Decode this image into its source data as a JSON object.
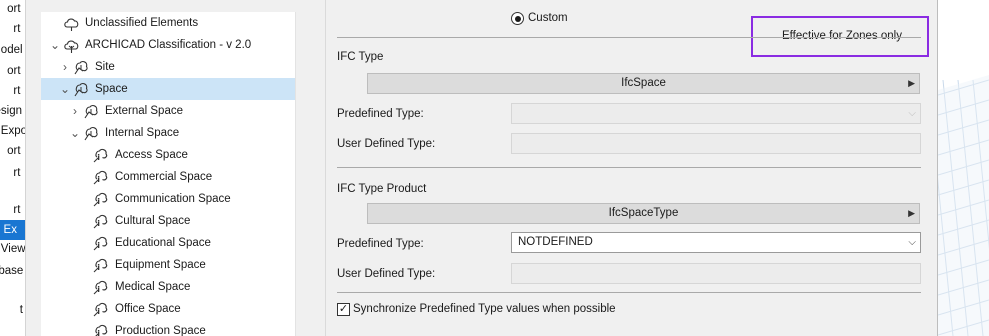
{
  "left_list": {
    "items": [
      {
        "text": "ort",
        "selected": false
      },
      {
        "text": "rt",
        "selected": false
      },
      {
        "text": "odel",
        "selected": false
      },
      {
        "text": "ort",
        "selected": false
      },
      {
        "text": "rt",
        "selected": false
      },
      {
        "text": "esign",
        "selected": false
      },
      {
        "text": "Expo",
        "selected": false
      },
      {
        "text": "ort",
        "selected": false
      },
      {
        "text": "rt",
        "selected": false
      },
      {
        "text": "rt",
        "selected": false
      },
      {
        "text": "ric Ex",
        "selected": true
      },
      {
        "text": "View",
        "selected": false
      },
      {
        "text": "-base",
        "selected": false
      },
      {
        "text": "t",
        "selected": false
      }
    ]
  },
  "tree": {
    "items": [
      {
        "label": "Unclassified Elements",
        "level": 0,
        "chevron": "",
        "icon": "unclassified-icon",
        "selected": false
      },
      {
        "label": "ARCHICAD Classification - v 2.0",
        "level": 0,
        "chevron": "⌄",
        "icon": "classification-icon",
        "selected": false
      },
      {
        "label": "Site",
        "level": 1,
        "chevron": "›",
        "icon": "zone-class-icon",
        "selected": false
      },
      {
        "label": "Space",
        "level": 1,
        "chevron": "⌄",
        "icon": "zone-class-icon",
        "selected": true
      },
      {
        "label": "External Space",
        "level": 2,
        "chevron": "›",
        "icon": "zone-class-icon",
        "selected": false
      },
      {
        "label": "Internal Space",
        "level": 2,
        "chevron": "⌄",
        "icon": "zone-class-icon",
        "selected": false
      },
      {
        "label": "Access Space",
        "level": 3,
        "chevron": "",
        "icon": "zone-leaf-icon",
        "selected": false
      },
      {
        "label": "Commercial Space",
        "level": 3,
        "chevron": "",
        "icon": "zone-leaf-icon",
        "selected": false
      },
      {
        "label": "Communication Space",
        "level": 3,
        "chevron": "",
        "icon": "zone-leaf-icon",
        "selected": false
      },
      {
        "label": "Cultural Space",
        "level": 3,
        "chevron": "",
        "icon": "zone-leaf-icon",
        "selected": false
      },
      {
        "label": "Educational Space",
        "level": 3,
        "chevron": "",
        "icon": "zone-leaf-icon",
        "selected": false
      },
      {
        "label": "Equipment Space",
        "level": 3,
        "chevron": "",
        "icon": "zone-leaf-icon",
        "selected": false
      },
      {
        "label": "Medical Space",
        "level": 3,
        "chevron": "",
        "icon": "zone-leaf-icon",
        "selected": false
      },
      {
        "label": "Office Space",
        "level": 3,
        "chevron": "",
        "icon": "zone-leaf-icon",
        "selected": false
      },
      {
        "label": "Production Space",
        "level": 3,
        "chevron": "",
        "icon": "zone-leaf-icon",
        "selected": false
      }
    ]
  },
  "panel": {
    "custom_radio_label": "Custom",
    "effective_note": "Effective for Zones only",
    "ifc_type": {
      "title": "IFC Type",
      "type_value": "IfcSpace",
      "predefined_label": "Predefined Type:",
      "predefined_value": "",
      "user_defined_label": "User Defined Type:",
      "user_defined_value": ""
    },
    "ifc_type_product": {
      "title": "IFC Type Product",
      "type_value": "IfcSpaceType",
      "predefined_label": "Predefined Type:",
      "predefined_value": "NOTDEFINED",
      "user_defined_label": "User Defined Type:",
      "user_defined_value": ""
    },
    "sync_label": "Synchronize Predefined Type values when possible",
    "sync_checked": true
  },
  "colors": {
    "accent_highlight": "#8a2be2",
    "tree_selection": "#cce4f7",
    "left_selection": "#1976d2"
  }
}
